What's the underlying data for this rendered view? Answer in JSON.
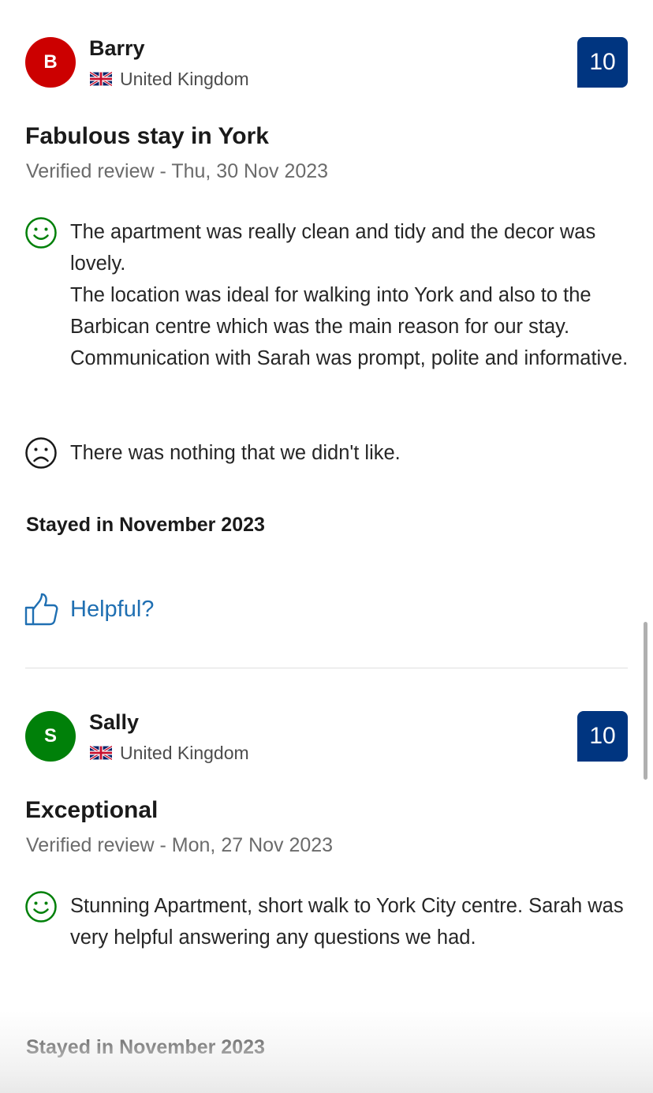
{
  "reviews": [
    {
      "avatar_letter": "B",
      "avatar_color": "#cc0000",
      "name": "Barry",
      "country": "United Kingdom",
      "score": "10",
      "title": "Fabulous stay in York",
      "date": "Verified review - Thu, 30 Nov 2023",
      "liked": "The apartment was really clean and tidy and the decor was lovely.\nThe location was ideal for walking into York and also to the Barbican centre which was the main reason for our stay. Communication  with Sarah was prompt, polite and informative.",
      "disliked": "There was nothing that we didn't like.",
      "stayed": "Stayed in November 2023",
      "helpful_label": "Helpful?"
    },
    {
      "avatar_letter": "S",
      "avatar_color": "#008009",
      "name": "Sally",
      "country": "United Kingdom",
      "score": "10",
      "title": "Exceptional",
      "date": "Verified review - Mon, 27 Nov 2023",
      "liked": "Stunning Apartment, short walk to York City centre. Sarah was very helpful answering any questions we had.",
      "stayed": "Stayed in November 2023"
    }
  ],
  "colors": {
    "score_badge": "#003580",
    "positive_icon": "#008009",
    "negative_icon": "#1a1a1a",
    "link": "#1f6fb2"
  },
  "icons": {
    "flag": "uk-flag-icon",
    "liked": "smile-icon",
    "disliked": "frown-icon",
    "helpful": "thumbs-up-icon"
  }
}
